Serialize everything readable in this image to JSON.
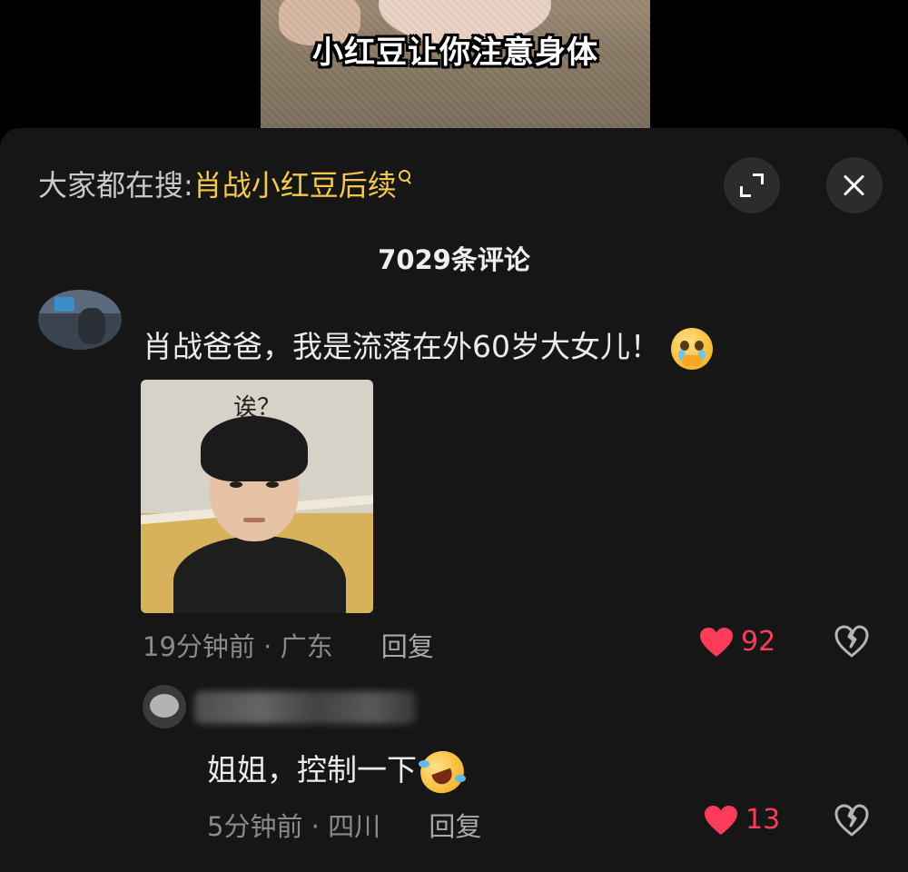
{
  "video": {
    "caption": "小红豆让你注意身体"
  },
  "header": {
    "search_prefix": "大家都在搜:",
    "search_term": "肖战小红豆后续",
    "comment_count": "7029条评论"
  },
  "comments": [
    {
      "text": "肖战爸爸，我是流落在外60岁大女儿！",
      "emoji": "crying-face-hands-icon",
      "image_caption": "诶？",
      "time": "19分钟前",
      "location": "广东",
      "separator": "·",
      "reply_label": "回复",
      "likes": "92",
      "liked": true
    },
    {
      "text": "姐姐，控制一下",
      "emoji": "rolling-laughing-icon",
      "time": "5分钟前",
      "location": "四川",
      "separator": "·",
      "reply_label": "回复",
      "likes": "13",
      "liked": true
    }
  ],
  "colors": {
    "accent_search": "#f2c94c",
    "like": "#ff3b5c",
    "sheet_bg": "#161616"
  }
}
